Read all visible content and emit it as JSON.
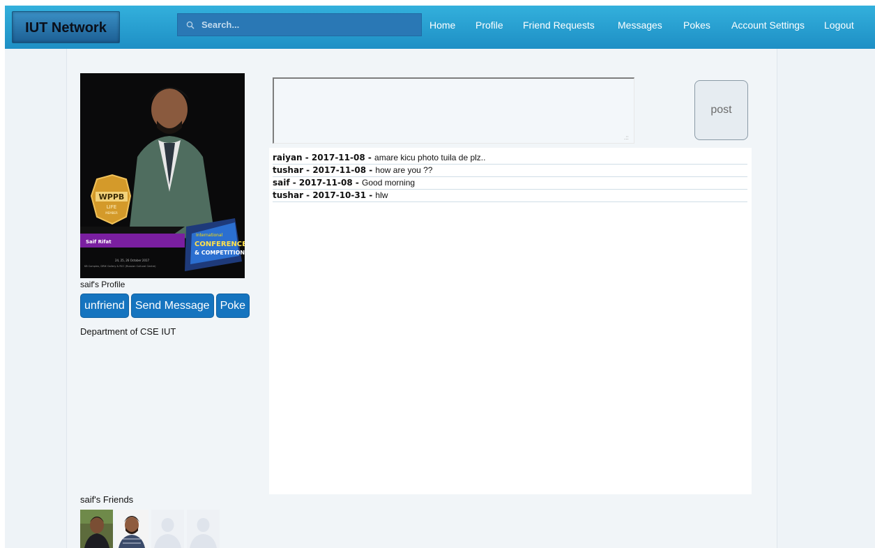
{
  "header": {
    "logo": "IUT Network",
    "search": {
      "placeholder": "Search..."
    },
    "nav": [
      "Home",
      "Profile",
      "Friend Requests",
      "Messages",
      "Pokes",
      "Account Settings",
      "Logout"
    ]
  },
  "profile": {
    "title": "saif's Profile",
    "actions": {
      "unfriend": "unfriend",
      "send_message": "Send Message",
      "poke": "Poke"
    },
    "department": "Department of CSE IUT",
    "photo": {
      "badge_top": "WPPB",
      "badge_life": "LIFE",
      "badge_member": "MEMBER",
      "name": "Saif Rifat",
      "event_line1": "International",
      "event_line2": "CONFERENCE",
      "event_line3": "& COMPETITION",
      "event_dates": "24, 25, 26 October 2017",
      "event_venue": "KB Complex, DRIK Gallery & RCC (Russian Cultural Centre)"
    }
  },
  "friends": {
    "title": "saif's Friends"
  },
  "composer": {
    "post_label": "post"
  },
  "feed": [
    {
      "meta": "raiyan - 2017-11-08 - ",
      "text": " amare kicu photo tuila de plz.."
    },
    {
      "meta": "tushar - 2017-11-08 - ",
      "text": "how are you ??"
    },
    {
      "meta": "saif - 2017-11-08 - ",
      "text": "Good morning"
    },
    {
      "meta": "tushar - 2017-10-31 - ",
      "text": " hlw"
    }
  ]
}
